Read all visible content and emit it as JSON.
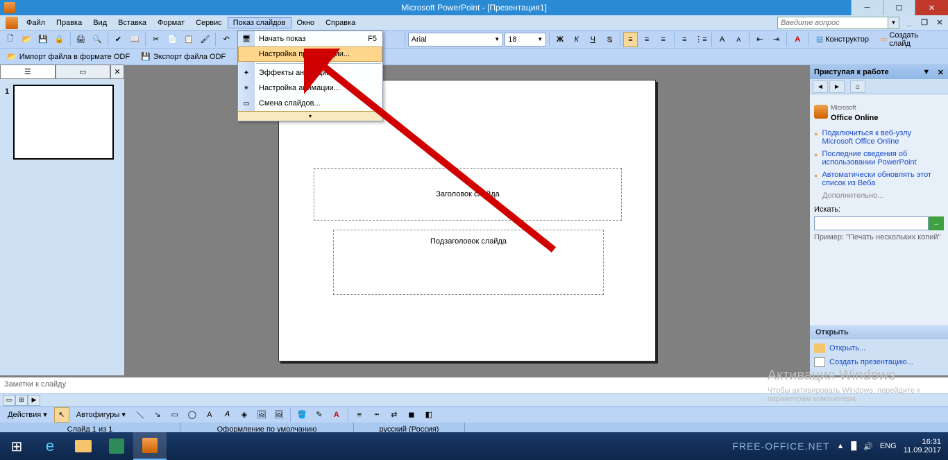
{
  "title": "Microsoft PowerPoint - [Презентация1]",
  "menubar": {
    "items": [
      "Файл",
      "Правка",
      "Вид",
      "Вставка",
      "Формат",
      "Сервис",
      "Показ слайдов",
      "Окно",
      "Справка"
    ],
    "question_placeholder": "Введите вопрос"
  },
  "toolbar1": {
    "font": "Arial",
    "size": "18"
  },
  "toolbar2": {
    "designer": "Конструктор",
    "new_slide": "Создать слайд"
  },
  "odf": {
    "import": "Импорт файла в формате ODF",
    "export": "Экспорт файла ODF"
  },
  "thumbs": {
    "tab_outline": "☰",
    "tab_slides": "▭",
    "tab_close": "✕",
    "n1": "1"
  },
  "dropdown": {
    "items": [
      {
        "label": "Начать показ",
        "shortcut": "F5",
        "hl": false
      },
      {
        "label": "Настройка презентации...",
        "shortcut": "",
        "hl": true
      },
      {
        "label": "Эффекты анимации...",
        "shortcut": "",
        "hl": false,
        "sep_before": true
      },
      {
        "label": "Настройка анимации...",
        "shortcut": "",
        "hl": false
      },
      {
        "label": "Смена слайдов...",
        "shortcut": "",
        "hl": false
      }
    ]
  },
  "slide": {
    "title": "Заголовок слайда",
    "subtitle": "Подзаголовок слайда"
  },
  "taskpane": {
    "header": "Приступая к работе",
    "office_online": "Office Online",
    "office_ms": "Microsoft",
    "links": [
      "Подключиться к веб-узлу Microsoft Office Online",
      "Последние сведения об использовании PowerPoint",
      "Автоматически обновлять этот список из Веба"
    ],
    "more": "Дополнительно...",
    "search_label": "Искать:",
    "example_pre": "Пример:",
    "example": "\"Печать нескольких копий\"",
    "open_header": "Открыть",
    "open_link": "Открыть...",
    "new_pres": "Создать презентацию..."
  },
  "notes": "Заметки к слайду",
  "drawbar": {
    "actions": "Действия",
    "autoshapes": "Автофигуры"
  },
  "status": {
    "slide": "Слайд 1 из 1",
    "design": "Оформление по умолчанию",
    "lang": "русский (Россия)"
  },
  "watermark": {
    "l1": "Активация Windows",
    "l2": "Чтобы активировать Windows, перейдите к",
    "l3": "параметрам компьютера."
  },
  "tray": {
    "lang": "ENG",
    "time": "16:31",
    "date": "11.09.2017",
    "freeoffice": "FREE-OFFICE.NET"
  }
}
